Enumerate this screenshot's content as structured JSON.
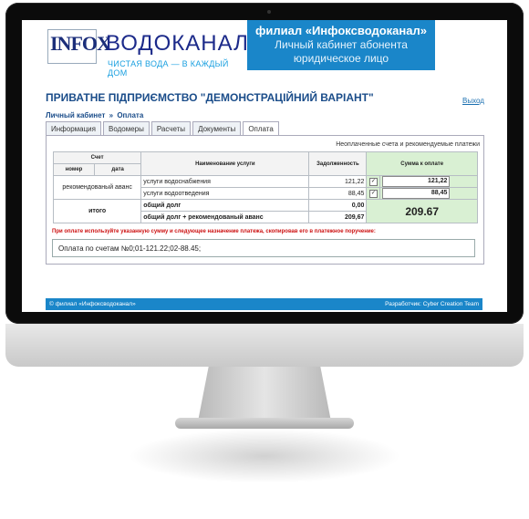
{
  "header": {
    "logo_letters": "INFOX",
    "brand_text": "ВОДОКАНАЛ",
    "tagline": "ЧИСТАЯ ВОДА — В КАЖДЫЙ ДОМ",
    "banner_title": "филиал «Инфоксводоканал»",
    "banner_sub1": "Личный кабинет абонента",
    "banner_sub2": "юридическое лицо"
  },
  "company_name": "ПРИВАТНЕ ПІДПРИЄМСТВО \"ДЕМОНСТРАЦІЙНИЙ ВАРІАНТ\"",
  "logout_label": "Выход",
  "breadcrumb": {
    "root": "Личный кабинет",
    "separator": "»",
    "current": "Оплата"
  },
  "tabs": [
    "Информация",
    "Водомеры",
    "Расчеты",
    "Документы",
    "Оплата"
  ],
  "panel_title": "Неоплаченные счета и рекомендуемые платежи",
  "table": {
    "header_invoice": "Счет",
    "header_number": "номер",
    "header_date": "дата",
    "header_service": "Наименование услуги",
    "header_debt": "Задолженность",
    "header_sum": "Сумма к оплате",
    "advance_label": "рекомендованый аванс",
    "rows": [
      {
        "service": "услуги водоснабжения",
        "debt": "121,22",
        "pay": "121,22"
      },
      {
        "service": "услуги водоотведения",
        "debt": "88,45",
        "pay": "88,45"
      }
    ],
    "total_label": "итого",
    "total_debt_label": "общий долг",
    "total_debt_value": "0,00",
    "total_with_advance_label": "общий долг + рекомендованый аванс",
    "total_with_advance_value": "209,67",
    "grand_total": "209.67"
  },
  "notice": "При оплате используйте указанную сумму и следующее назначение платежа, скопировав его в платежное поручение:",
  "payment_purpose": "Оплата по счетам №0;01-121.22;02-88.45;",
  "footer": {
    "copyright": "© филиал «Инфоксводоканал»",
    "developer": "Разработчик: Cyber Creation Team"
  },
  "colors": {
    "brand_blue": "#1a86c9",
    "accent_green": "#d9f0d3",
    "notice_red": "#cc1010"
  }
}
